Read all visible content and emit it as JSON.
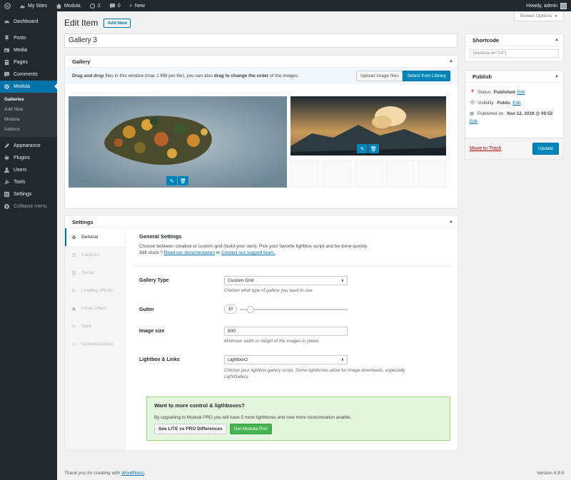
{
  "adminbar": {
    "my_sites": "My Sites",
    "site": "Modula",
    "updates": "2",
    "comments": "0",
    "new": "New",
    "howdy": "Howdy, admin"
  },
  "sidebar": {
    "items": [
      {
        "label": "Dashboard",
        "icon": "dashboard-icon"
      },
      {
        "label": "Posts",
        "icon": "pin-icon"
      },
      {
        "label": "Media",
        "icon": "media-icon"
      },
      {
        "label": "Pages",
        "icon": "pages-icon"
      },
      {
        "label": "Comments",
        "icon": "comments-icon"
      },
      {
        "label": "Modula",
        "icon": "gear-icon"
      }
    ],
    "submenu": [
      "Galleries",
      "Add New",
      "Modula",
      "Addons"
    ],
    "items2": [
      {
        "label": "Appearance",
        "icon": "brush-icon"
      },
      {
        "label": "Plugins",
        "icon": "plugin-icon"
      },
      {
        "label": "Users",
        "icon": "users-icon"
      },
      {
        "label": "Tools",
        "icon": "wrench-icon"
      },
      {
        "label": "Settings",
        "icon": "settings-icon"
      }
    ],
    "collapse": "Collapse menu"
  },
  "header": {
    "screen_options": "Screen Options",
    "title": "Edit Item",
    "add_new": "Add New"
  },
  "gallery_title": "Gallery 3",
  "gallery_box": {
    "title": "Gallery",
    "dz_part1": "Drag and drop",
    "dz_part2": " files in this window (max 1 MB per file), you can also ",
    "dz_part3": "drag to change the order",
    "dz_part4": " of the images.",
    "upload": "Upload image files",
    "library": "Select from Library"
  },
  "shortcode": {
    "title": "Shortcode",
    "value": "[modula id=\"14\"]"
  },
  "publish": {
    "title": "Publish",
    "status_label": "Status: ",
    "status": "Published",
    "visibility_label": "Visibility: ",
    "visibility": "Public",
    "published_label": "Published on: ",
    "published_date": "Nov 12, 2018 @ 09:52",
    "edit": "Edit",
    "trash": "Move to Trash",
    "update": "Update"
  },
  "settings": {
    "title": "Settings",
    "tabs": [
      "General",
      "Captions",
      "Social",
      "Loading effects",
      "Hover effect",
      "Style",
      "Customizations"
    ],
    "heading": "General Settings",
    "desc1": "Choose between creative or custom grid (build your own). Pick your favorite lightbox script and be done quickly.",
    "desc2": "Still stuck ? ",
    "doc_link": "Read our documentation",
    "or": " or ",
    "support_link": "Contact our support team.",
    "gallery_type_label": "Gallery Type",
    "gallery_type_value": "Custom Grid",
    "gallery_type_hint": "Choose what type of gallery you want to use.",
    "gutter_label": "Gutter",
    "gutter_value": "10",
    "gutter_slider_max": 100,
    "image_size_label": "Image size",
    "image_size_value": "500",
    "image_size_hint": "Minimum width or height of the images in pixels.",
    "lightbox_label": "Lightbox & Links",
    "lightbox_value": "Lightbox2",
    "lightbox_hint1": "Choose your lightbox gallery script. Some lightboxes allow for image downloads, especially",
    "lightbox_hint2": "LightGallery.",
    "promo_title": "Want to more control & ligthboxes?",
    "promo_text": "By upgrading to Modula PRO you will have 5 more lightboxes and new more customization avaible.",
    "compare": "See LITE vs PRO Differences",
    "get_pro": "Get Modula Pro!"
  },
  "footer": {
    "text": "Thank you for creating with ",
    "link": "WordPress",
    "dot": ".",
    "version": "Version 4.9.8"
  },
  "colors": {
    "accent": "#0073aa",
    "button": "#0085ba",
    "green": "#46b450"
  }
}
